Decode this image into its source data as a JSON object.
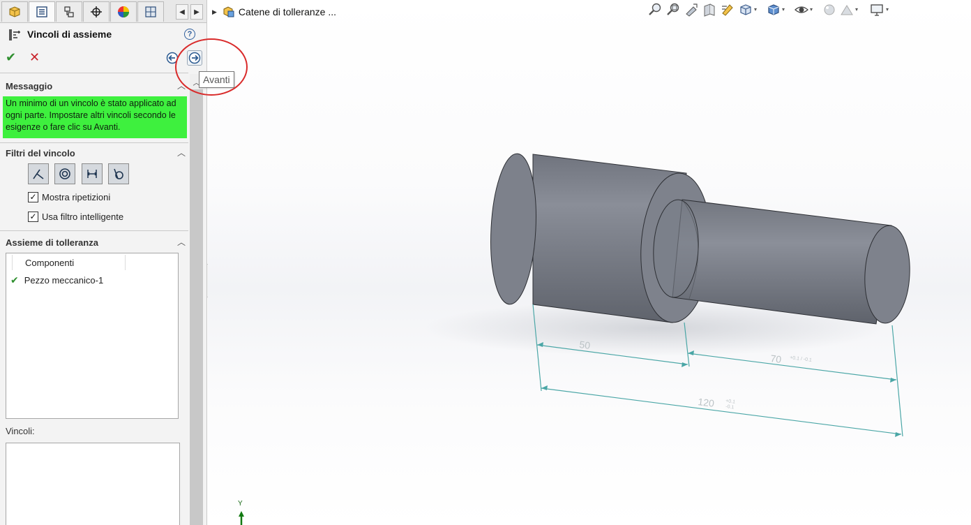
{
  "tabs": [
    {
      "name": "feature-manager",
      "icon": "featuremanager-icon",
      "active": false
    },
    {
      "name": "property-manager",
      "icon": "propertymanager-icon",
      "active": true
    },
    {
      "name": "configuration-manager",
      "icon": "configurationmanager-icon",
      "active": false
    },
    {
      "name": "dimxpert-manager",
      "icon": "dimxpertmanager-icon",
      "active": false
    },
    {
      "name": "display-manager",
      "icon": "displaymanager-icon",
      "active": false
    },
    {
      "name": "tolanalyst",
      "icon": "tolanalyst-icon",
      "active": false
    }
  ],
  "property_manager": {
    "title": "Vincoli di assieme",
    "help": "?",
    "ok_symbol": "✔",
    "cancel_symbol": "✕",
    "tooltip": "Avanti"
  },
  "message_section": {
    "title": "Messaggio",
    "text": "Un minimo di un vincolo è stato applicato ad ogni parte. Impostare altri vincoli secondo le esigenze o fare clic su Avanti."
  },
  "filters_section": {
    "title": "Filtri del vincolo",
    "checkboxes": [
      {
        "label": "Mostra ripetizioni",
        "checked": true
      },
      {
        "label": "Usa filtro intelligente",
        "checked": true
      }
    ]
  },
  "tolerance_section": {
    "title": "Assieme di tolleranza",
    "column_header": "Componenti",
    "components": [
      "Pezzo meccanico-1"
    ],
    "mates_label": "Vincoli:"
  },
  "viewport": {
    "breadcrumb": "Catene di tolleranze ...",
    "dimensions": {
      "d1": "50",
      "d2": "70",
      "d2_tol": "+0.1 / -0.1",
      "d3": "120",
      "d3_tol_upper": "+0.1",
      "d3_tol_lower": "-0.1"
    },
    "triad_label": "Y"
  },
  "colors": {
    "message_bg": "#3ef03e",
    "part_fill": "#797d87",
    "dimension_line": "#4aa6a6",
    "highlight": "#d92a2a"
  }
}
